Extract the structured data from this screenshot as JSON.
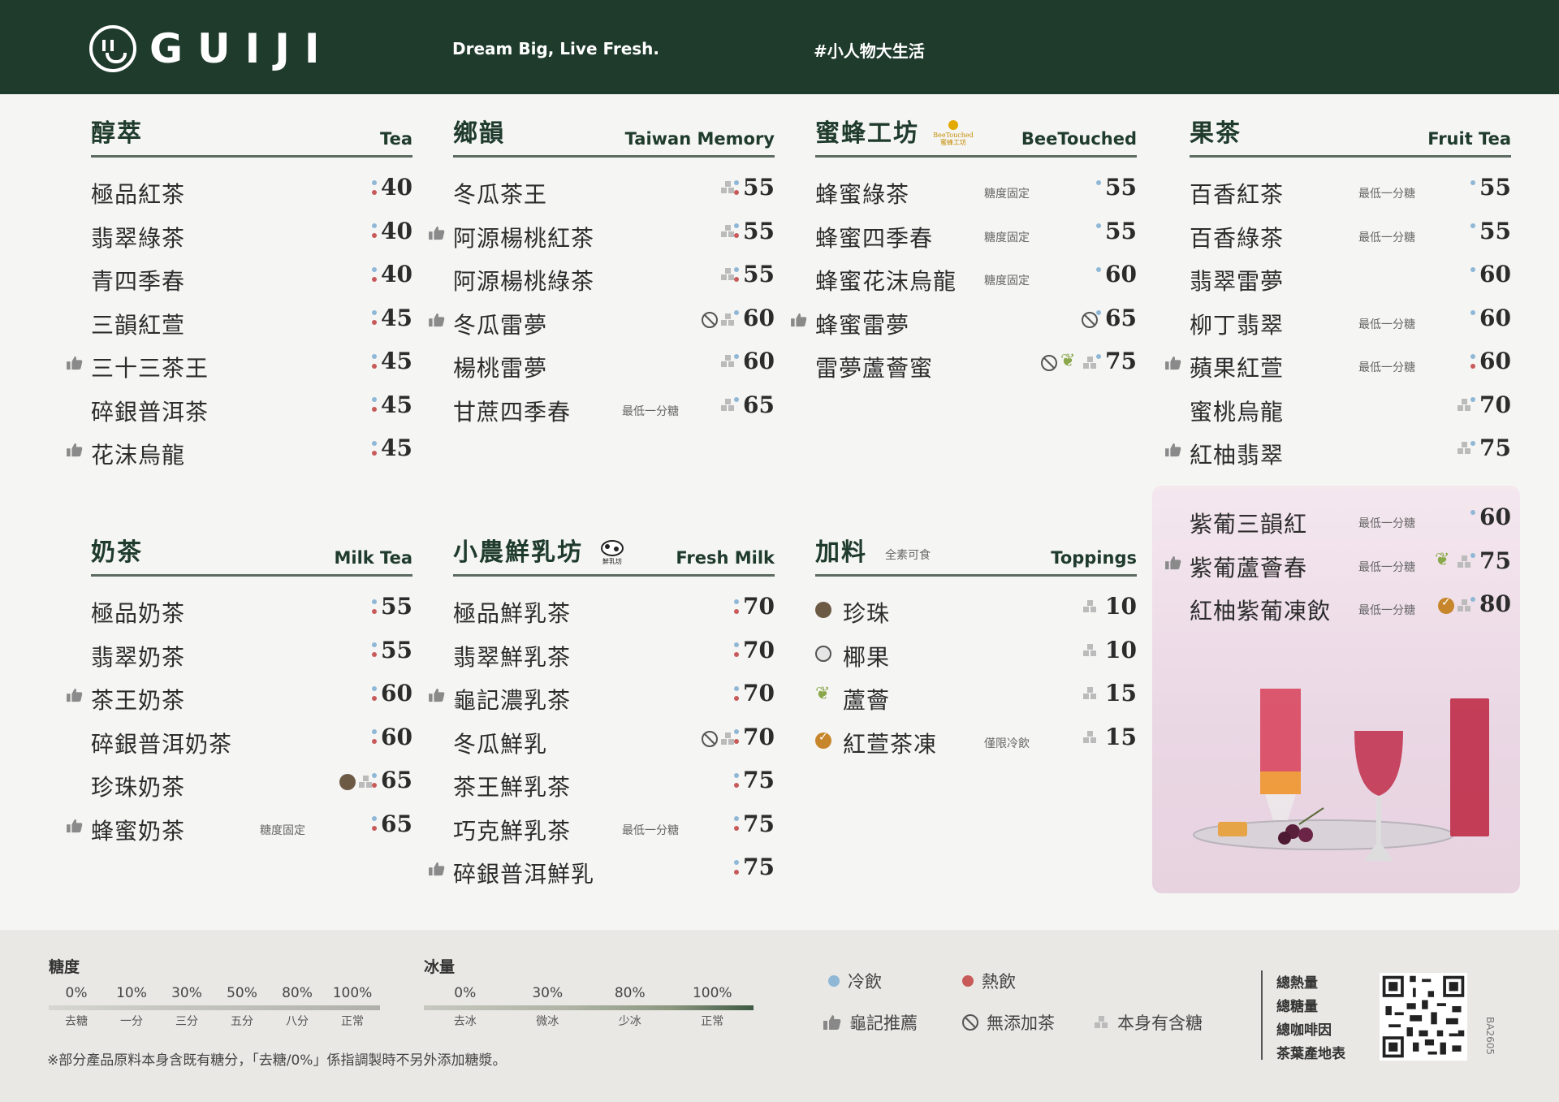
{
  "header": {
    "brand": "GUIJI",
    "tagline": "Dream Big, Live Fresh.",
    "hashtag": "#小人物大生活"
  },
  "sections": {
    "tea": {
      "title": "醇萃",
      "en": "Tea",
      "items": [
        {
          "name": "極品紅茶",
          "price": "40",
          "temp": [
            "cold",
            "hot"
          ],
          "rec": false
        },
        {
          "name": "翡翠綠茶",
          "price": "40",
          "temp": [
            "cold",
            "hot"
          ],
          "rec": false
        },
        {
          "name": "青四季春",
          "price": "40",
          "temp": [
            "cold",
            "hot"
          ],
          "rec": false
        },
        {
          "name": "三韻紅萱",
          "price": "45",
          "temp": [
            "cold",
            "hot"
          ],
          "rec": false
        },
        {
          "name": "三十三茶王",
          "price": "45",
          "temp": [
            "cold",
            "hot"
          ],
          "rec": true
        },
        {
          "name": "碎銀普洱茶",
          "price": "45",
          "temp": [
            "cold",
            "hot"
          ],
          "rec": false
        },
        {
          "name": "花沫烏龍",
          "price": "45",
          "temp": [
            "cold",
            "hot"
          ],
          "rec": true
        }
      ]
    },
    "taiwan": {
      "title": "鄉韻",
      "en": "Taiwan Memory",
      "items": [
        {
          "name": "冬瓜茶王",
          "price": "55",
          "temp": [
            "cold",
            "hot"
          ],
          "rec": false,
          "icons": [
            "sugar"
          ]
        },
        {
          "name": "阿源楊桃紅茶",
          "price": "55",
          "temp": [
            "cold",
            "hot"
          ],
          "rec": true,
          "icons": [
            "sugar"
          ]
        },
        {
          "name": "阿源楊桃綠茶",
          "price": "55",
          "temp": [
            "cold",
            "hot"
          ],
          "rec": false,
          "icons": [
            "sugar"
          ]
        },
        {
          "name": "冬瓜雷夢",
          "price": "60",
          "temp": [
            "cold"
          ],
          "rec": true,
          "icons": [
            "noadd",
            "sugar"
          ]
        },
        {
          "name": "楊桃雷夢",
          "price": "60",
          "temp": [
            "cold"
          ],
          "rec": false,
          "icons": [
            "sugar"
          ]
        },
        {
          "name": "甘蔗四季春",
          "price": "65",
          "temp": [
            "cold"
          ],
          "rec": false,
          "note": "最低一分糖",
          "icons": [
            "sugar"
          ]
        }
      ]
    },
    "bee": {
      "title": "蜜蜂工坊",
      "en": "BeeTouched",
      "badge": "BeeTouched 蜜蜂工坊",
      "items": [
        {
          "name": "蜂蜜綠茶",
          "price": "55",
          "temp": [
            "cold"
          ],
          "rec": false,
          "note": "糖度固定"
        },
        {
          "name": "蜂蜜四季春",
          "price": "55",
          "temp": [
            "cold"
          ],
          "rec": false,
          "note": "糖度固定"
        },
        {
          "name": "蜂蜜花沫烏龍",
          "price": "60",
          "temp": [
            "cold"
          ],
          "rec": false,
          "note": "糖度固定"
        },
        {
          "name": "蜂蜜雷夢",
          "price": "65",
          "temp": [
            "cold"
          ],
          "rec": true,
          "icons": [
            "noadd"
          ]
        },
        {
          "name": "雷夢蘆薈蜜",
          "price": "75",
          "temp": [
            "cold"
          ],
          "rec": false,
          "icons": [
            "noadd",
            "aloe",
            "sugar"
          ]
        }
      ]
    },
    "fruit": {
      "title": "果茶",
      "en": "Fruit Tea",
      "items": [
        {
          "name": "百香紅茶",
          "price": "55",
          "temp": [
            "cold"
          ],
          "rec": false,
          "note": "最低一分糖"
        },
        {
          "name": "百香綠茶",
          "price": "55",
          "temp": [
            "cold"
          ],
          "rec": false,
          "note": "最低一分糖"
        },
        {
          "name": "翡翠雷夢",
          "price": "60",
          "temp": [
            "cold"
          ],
          "rec": false
        },
        {
          "name": "柳丁翡翠",
          "price": "60",
          "temp": [
            "cold"
          ],
          "rec": false,
          "note": "最低一分糖"
        },
        {
          "name": "蘋果紅萱",
          "price": "60",
          "temp": [
            "cold",
            "hot"
          ],
          "rec": true,
          "note": "最低一分糖"
        },
        {
          "name": "蜜桃烏龍",
          "price": "70",
          "temp": [
            "cold"
          ],
          "rec": false,
          "icons": [
            "sugar"
          ]
        },
        {
          "name": "紅柚翡翠",
          "price": "75",
          "temp": [
            "cold"
          ],
          "rec": true,
          "icons": [
            "sugar"
          ]
        }
      ]
    },
    "promo": {
      "items": [
        {
          "name": "紫葡三韻紅",
          "price": "60",
          "temp": [
            "cold"
          ],
          "rec": false,
          "note": "最低一分糖"
        },
        {
          "name": "紫葡蘆薈春",
          "price": "75",
          "temp": [
            "cold"
          ],
          "rec": true,
          "note": "最低一分糖",
          "icons": [
            "aloe",
            "sugar"
          ]
        },
        {
          "name": "紅柚紫葡凍飲",
          "price": "80",
          "temp": [
            "cold"
          ],
          "rec": false,
          "note": "最低一分糖",
          "icons": [
            "jelly",
            "sugar"
          ]
        }
      ]
    },
    "milktea": {
      "title": "奶茶",
      "en": "Milk Tea",
      "items": [
        {
          "name": "極品奶茶",
          "price": "55",
          "temp": [
            "cold",
            "hot"
          ],
          "rec": false
        },
        {
          "name": "翡翠奶茶",
          "price": "55",
          "temp": [
            "cold",
            "hot"
          ],
          "rec": false
        },
        {
          "name": "茶王奶茶",
          "price": "60",
          "temp": [
            "cold",
            "hot"
          ],
          "rec": true
        },
        {
          "name": "碎銀普洱奶茶",
          "price": "60",
          "temp": [
            "cold",
            "hot"
          ],
          "rec": false
        },
        {
          "name": "珍珠奶茶",
          "price": "65",
          "temp": [
            "cold",
            "hot"
          ],
          "rec": false,
          "icons": [
            "pearl",
            "sugar"
          ]
        },
        {
          "name": "蜂蜜奶茶",
          "price": "65",
          "temp": [
            "cold",
            "hot"
          ],
          "rec": true,
          "note": "糖度固定"
        }
      ]
    },
    "freshmilk": {
      "title": "小農鮮乳坊",
      "en": "Fresh Milk",
      "badge": "鮮乳坊",
      "items": [
        {
          "name": "極品鮮乳茶",
          "price": "70",
          "temp": [
            "cold",
            "hot"
          ],
          "rec": false
        },
        {
          "name": "翡翠鮮乳茶",
          "price": "70",
          "temp": [
            "cold",
            "hot"
          ],
          "rec": false
        },
        {
          "name": "龜記濃乳茶",
          "price": "70",
          "temp": [
            "cold",
            "hot"
          ],
          "rec": true
        },
        {
          "name": "冬瓜鮮乳",
          "price": "70",
          "temp": [
            "cold",
            "hot"
          ],
          "rec": false,
          "icons": [
            "noadd",
            "sugar"
          ]
        },
        {
          "name": "茶王鮮乳茶",
          "price": "75",
          "temp": [
            "cold",
            "hot"
          ],
          "rec": false
        },
        {
          "name": "巧克鮮乳茶",
          "price": "75",
          "temp": [
            "cold",
            "hot"
          ],
          "rec": false,
          "note": "最低一分糖"
        },
        {
          "name": "碎銀普洱鮮乳",
          "price": "75",
          "temp": [
            "cold",
            "hot"
          ],
          "rec": true
        }
      ]
    },
    "toppings": {
      "title": "加料",
      "en": "Toppings",
      "sub": "全素可食",
      "items": [
        {
          "name": "珍珠",
          "price": "10",
          "icon": "pearl",
          "icons": [
            "sugar"
          ]
        },
        {
          "name": "椰果",
          "price": "10",
          "icon": "coco",
          "icons": [
            "sugar"
          ]
        },
        {
          "name": "蘆薈",
          "price": "15",
          "icon": "aloe",
          "icons": [
            "sugar"
          ]
        },
        {
          "name": "紅萱茶凍",
          "price": "15",
          "icon": "jelly",
          "note": "僅限冷飲",
          "icons": [
            "sugar"
          ]
        }
      ]
    }
  },
  "footer": {
    "sugar_title": "糖度",
    "sugar_levels": [
      "0%",
      "10%",
      "30%",
      "50%",
      "80%",
      "100%"
    ],
    "sugar_labels": [
      "去糖",
      "一分",
      "三分",
      "五分",
      "八分",
      "正常"
    ],
    "ice_title": "冰量",
    "ice_levels": [
      "0%",
      "30%",
      "80%",
      "100%"
    ],
    "ice_labels": [
      "去冰",
      "微冰",
      "少冰",
      "正常"
    ],
    "note": "※部分產品原料本身含既有糖分，「去糖/0%」係指調製時不另外添加糖漿。",
    "legend": {
      "cold": "冷飲",
      "hot": "熱飲",
      "rec": "龜記推薦",
      "noadd": "無添加茶",
      "sugar": "本身有含糖"
    },
    "info": [
      "總熱量",
      "總糖量",
      "總咖啡因",
      "茶葉產地表"
    ],
    "code": "BA2605"
  },
  "colors": {
    "header": "#1f3b2c",
    "cold": "#8fb7d6",
    "hot": "#c85a5a",
    "promo": "#ecdbe6"
  }
}
